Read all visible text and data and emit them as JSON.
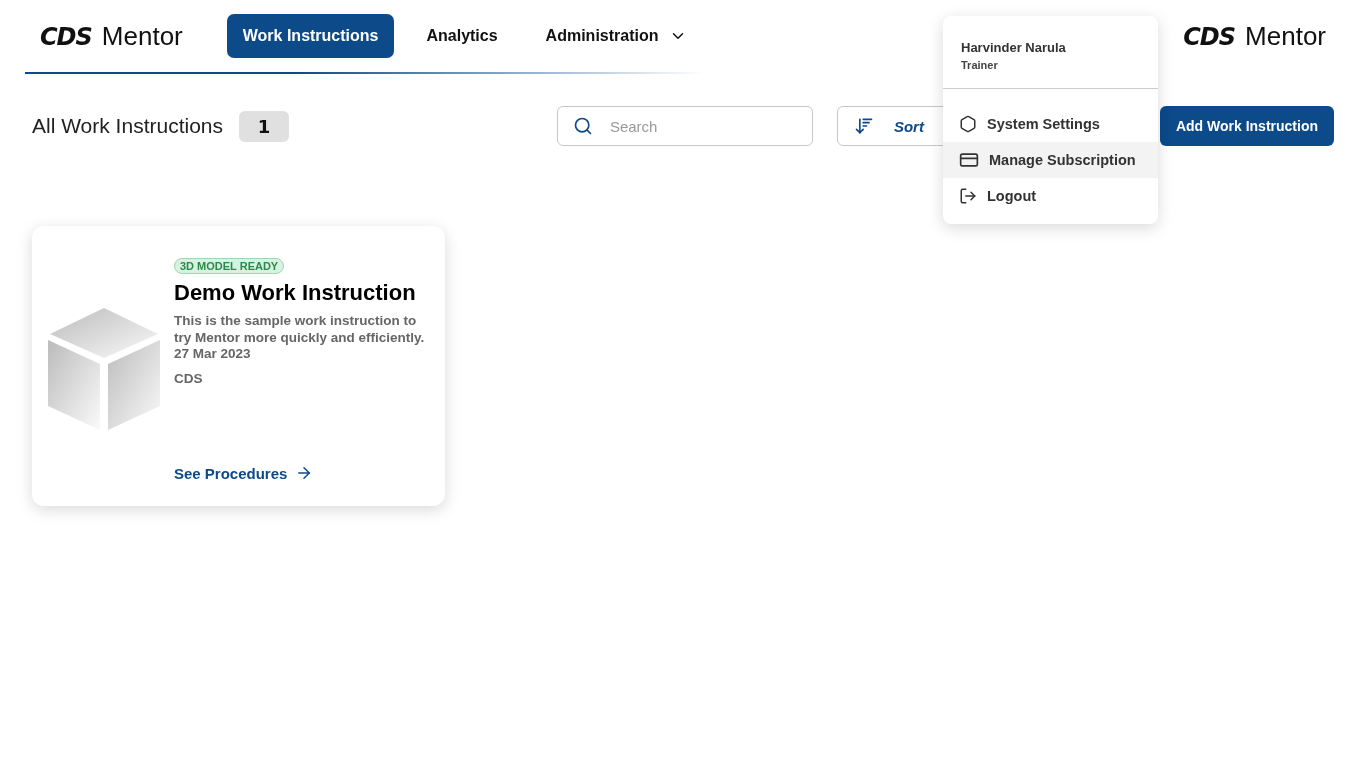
{
  "header": {
    "logo": {
      "mark": "CDS",
      "name": "Mentor"
    },
    "nav": [
      {
        "label": "Work Instructions",
        "selected": true,
        "kind": "link"
      },
      {
        "label": "Analytics",
        "selected": false,
        "kind": "link"
      },
      {
        "label": "Administration",
        "selected": false,
        "kind": "dropdown"
      }
    ],
    "right_logo": {
      "mark": "CDS",
      "name": "Mentor"
    }
  },
  "toolbar": {
    "title": "All Work Instructions",
    "count": "1",
    "search": {
      "placeholder": "Search"
    },
    "sort": "Sort",
    "add_button": "Add Work Instruction"
  },
  "cards": [
    {
      "badge": "3D MODEL READY",
      "title": "Demo Work Instruction",
      "description": "This is the sample work instruction to try Mentor more quickly and efficiently.",
      "date": "27 Mar 2023",
      "owner": "CDS",
      "link": "See Procedures"
    }
  ],
  "user_menu": {
    "name": "Harvinder Narula",
    "role": "Trainer",
    "items": [
      {
        "label": "System Settings",
        "kind": "settings",
        "selected": false
      },
      {
        "label": "Manage Subscription",
        "kind": "subscription",
        "selected": true
      },
      {
        "label": "Logout",
        "kind": "logout",
        "selected": false
      }
    ]
  }
}
